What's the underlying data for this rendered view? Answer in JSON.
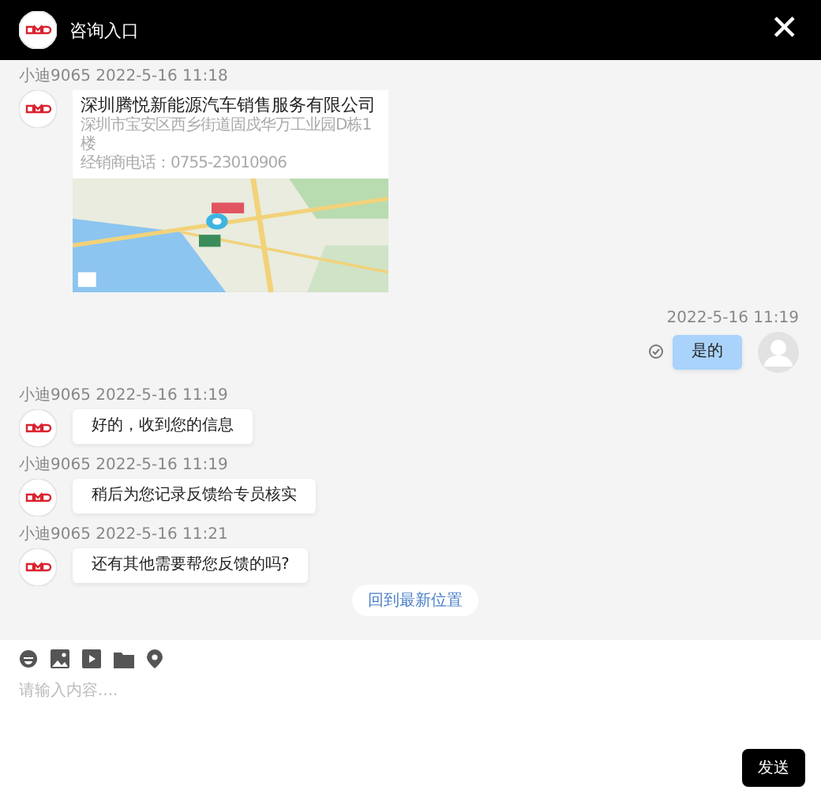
{
  "header": {
    "title": "咨询入口",
    "close": "✕"
  },
  "messages": [
    {
      "kind": "location",
      "outgoing": false,
      "sender": "小迪9065",
      "time": "2022-5-16 11:18",
      "name": "深圳腾悦新能源汽车销售服务有限公司",
      "address": "深圳市宝安区西乡街道固戍华万工业园D栋1楼",
      "phone": "经销商电话：0755-23010906"
    },
    {
      "kind": "text",
      "outgoing": true,
      "time": "2022-5-16 11:19",
      "text": "是的",
      "read": true
    },
    {
      "kind": "text",
      "outgoing": false,
      "sender": "小迪9065",
      "time": "2022-5-16 11:19",
      "text": "好的，收到您的信息"
    },
    {
      "kind": "text",
      "outgoing": false,
      "sender": "小迪9065",
      "time": "2022-5-16 11:19",
      "text": "稍后为您记录反馈给专员核实"
    },
    {
      "kind": "text",
      "outgoing": false,
      "sender": "小迪9065",
      "time": "2022-5-16 11:21",
      "text": "还有其他需要帮您反馈的吗?"
    }
  ],
  "jump_button": "回到最新位置",
  "composer": {
    "placeholder": "请输入内容....",
    "send": "发送"
  }
}
